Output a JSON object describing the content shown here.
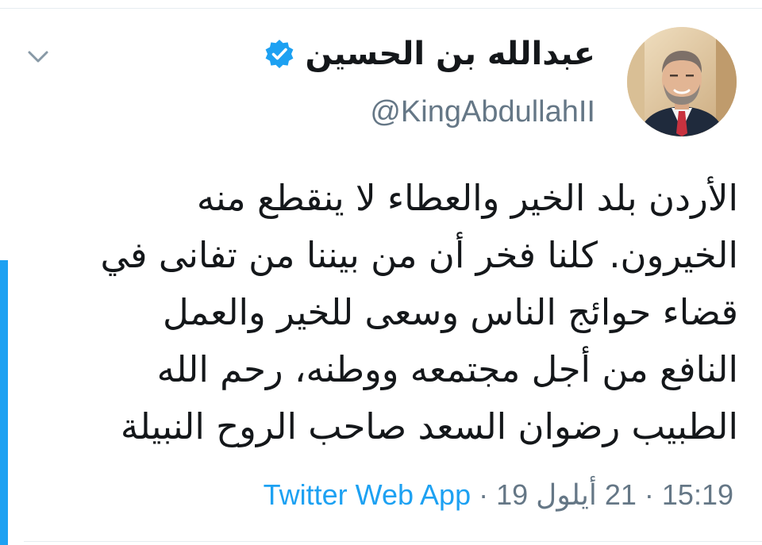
{
  "colors": {
    "accent_blue": "#1da1f2",
    "text_primary": "#14171a",
    "text_secondary": "#657786"
  },
  "tweet": {
    "author": {
      "display_name": "عبدالله بن الحسين",
      "handle": "@KingAbdullahII",
      "verified": true,
      "verified_icon": "verified-badge-icon",
      "avatar_icon": "avatar-photo"
    },
    "body_lines": [
      "الأردن بلد الخير والعطاء لا ينقطع منه",
      "الخيرون. كلنا فخر أن من بيننا من تفانى في",
      "قضاء حوائج الناس وسعى للخير والعمل",
      "النافع من أجل مجتمعه ووطنه، رحم الله",
      "الطبيب رضوان السعد صاحب الروح النبيلة"
    ],
    "meta": {
      "time": "15:19",
      "separator": "·",
      "date": "21 أيلول 19",
      "source": "Twitter Web App"
    },
    "menu_icon": "chevron-down-icon"
  }
}
